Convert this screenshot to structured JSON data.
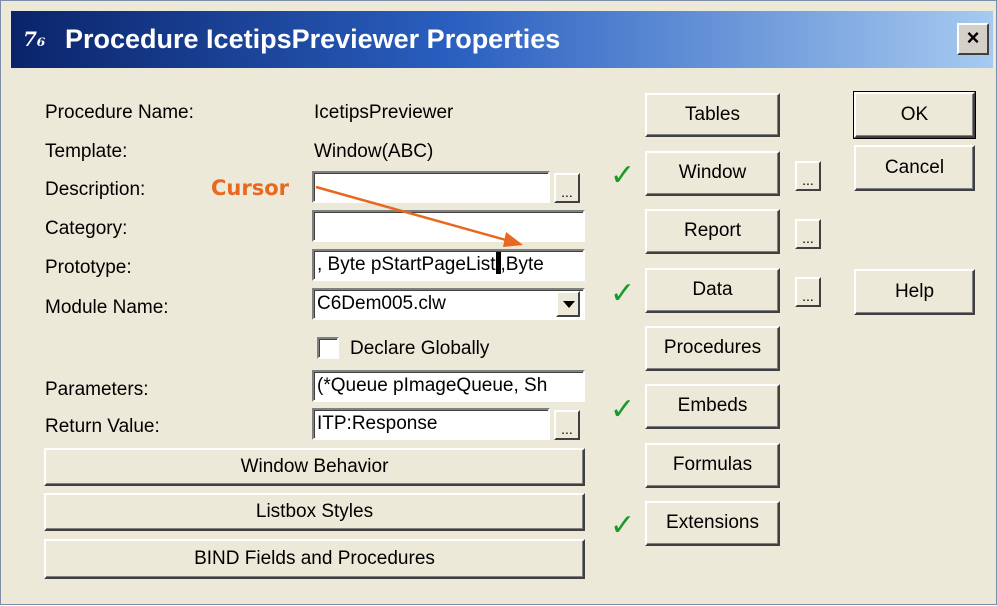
{
  "window": {
    "title": "Procedure IcetipsPreviewer Properties",
    "icon_label": "7₆",
    "close_label": "×"
  },
  "form": {
    "procedure_name_label": "Procedure Name:",
    "procedure_name_value": "IcetipsPreviewer",
    "template_label": "Template:",
    "template_value": "Window(ABC)",
    "description_label": "Description:",
    "description_value": "",
    "category_label": "Category:",
    "category_value": "",
    "prototype_label": "Prototype:",
    "prototype_value_before_caret": ", Byte pStartPageList",
    "prototype_value_after_caret": ",Byte",
    "module_name_label": "Module Name:",
    "module_name_value": "C6Dem005.clw",
    "declare_globally_label": "Declare Globally",
    "declare_globally_checked": false,
    "parameters_label": "Parameters:",
    "parameters_value": "(*Queue pImageQueue, Sh",
    "return_value_label": "Return Value:",
    "return_value_value": "ITP:Response",
    "ellipsis_label": "..."
  },
  "wide_buttons": {
    "window_behavior": "Window Behavior",
    "listbox_styles": "Listbox Styles",
    "bind_fields": "BIND Fields and Procedures"
  },
  "middle_buttons": {
    "tables": "Tables",
    "window": "Window",
    "report": "Report",
    "data": "Data",
    "procedures": "Procedures",
    "embeds": "Embeds",
    "formulas": "Formulas",
    "extensions": "Extensions"
  },
  "right_buttons": {
    "ok": "OK",
    "cancel": "Cancel",
    "help": "Help"
  },
  "checkmark": "✓",
  "annotation": {
    "text": "Cursor",
    "color": "#e8681e"
  },
  "colors": {
    "title_start": "#0a246a",
    "title_end": "#a6caf0",
    "check": "#1a9a2a",
    "dialog_bg": "#ece9d8"
  }
}
